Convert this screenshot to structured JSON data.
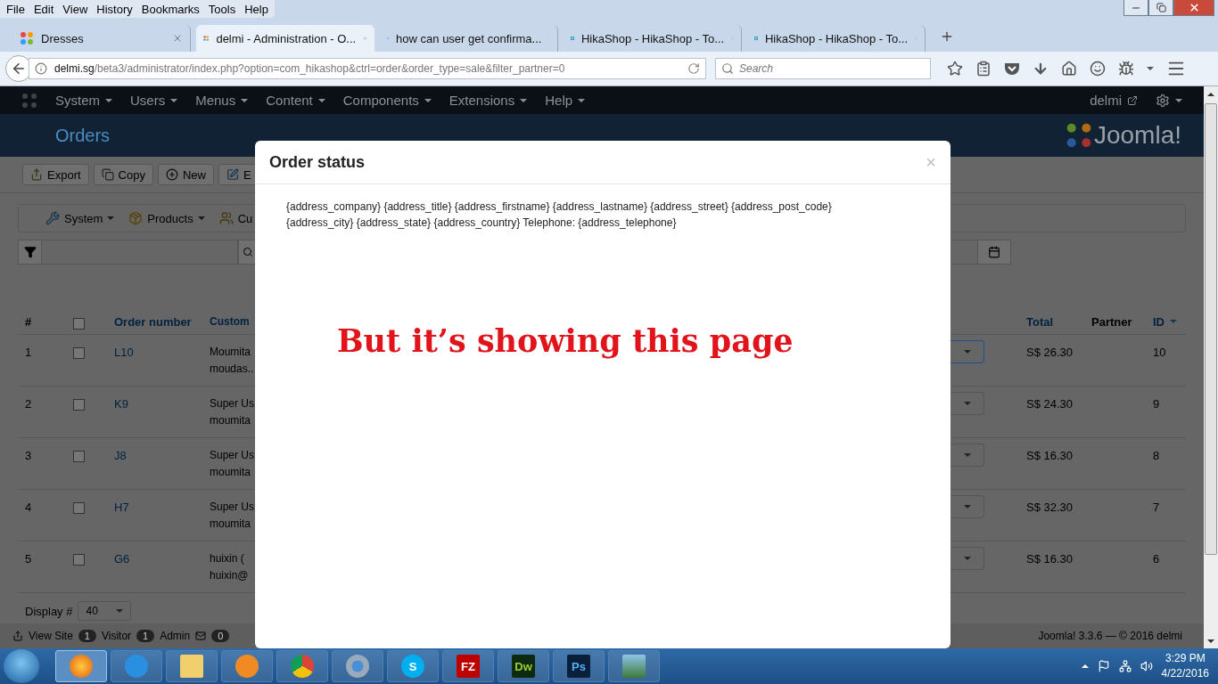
{
  "browser": {
    "menu": [
      "File",
      "Edit",
      "View",
      "History",
      "Bookmarks",
      "Tools",
      "Help"
    ],
    "tabs": [
      {
        "title": "Dresses",
        "kind": "joomla",
        "selected": false
      },
      {
        "title": "delmi - Administration - O...",
        "kind": "joomla",
        "selected": true
      },
      {
        "title": "how can user get confirma...",
        "kind": "google",
        "selected": false
      },
      {
        "title": "HikaShop - HikaShop - To...",
        "kind": "hikashop",
        "selected": false
      },
      {
        "title": "HikaShop - HikaShop - To...",
        "kind": "hikashop",
        "selected": false
      }
    ],
    "url": {
      "host": "delmi.sg",
      "path": "/beta3/administrator/index.php?option=com_hikashop&ctrl=order&order_type=sale&filter_partner=0"
    },
    "search": {
      "placeholder": "Search"
    }
  },
  "admin": {
    "nav": [
      "System",
      "Users",
      "Menus",
      "Content",
      "Components",
      "Extensions",
      "Help"
    ],
    "user": "delmi",
    "page_title": "Orders",
    "logo_text": "Joomla!",
    "toolbar": [
      {
        "label": "Export",
        "kind": "export"
      },
      {
        "label": "Copy",
        "kind": "copy"
      },
      {
        "label": "New",
        "kind": "new"
      },
      {
        "label": "E",
        "kind": "edit"
      }
    ],
    "submenu": [
      {
        "label": "System",
        "kind": "system"
      },
      {
        "label": "Products",
        "kind": "products"
      },
      {
        "label": "Cu",
        "kind": "customers"
      }
    ],
    "table": {
      "columns": [
        {
          "label": "#",
          "kind": "plain",
          "sorted": false
        },
        {
          "kind": "checkbox",
          "checked": false
        },
        {
          "label": "Order number",
          "kind": "link",
          "sorted": false
        },
        {
          "label": "Custom",
          "kind": "link"
        },
        {
          "label": "Total",
          "kind": "link",
          "sorted": false
        },
        {
          "label": "Partner",
          "kind": "plain",
          "sorted": false
        },
        {
          "label": "ID",
          "kind": "link",
          "sorted": true
        }
      ],
      "rows": [
        {
          "number": "1",
          "checked": false,
          "order_number": "L10",
          "customer": [
            "Moumita",
            "moudas.."
          ],
          "status_focused": true,
          "total": "S$ 26.30",
          "id": "10"
        },
        {
          "number": "2",
          "checked": false,
          "order_number": "K9",
          "customer": [
            "Super Us",
            "moumita"
          ],
          "status_focused": false,
          "total": "S$ 24.30",
          "id": "9"
        },
        {
          "number": "3",
          "checked": false,
          "order_number": "J8",
          "customer": [
            "Super Us",
            "moumita"
          ],
          "status_focused": false,
          "total": "S$ 16.30",
          "id": "8"
        },
        {
          "number": "4",
          "checked": false,
          "order_number": "H7",
          "customer": [
            "Super Us",
            "moumita"
          ],
          "status_focused": false,
          "total": "S$ 32.30",
          "id": "7"
        },
        {
          "number": "5",
          "checked": false,
          "order_number": "G6",
          "customer": [
            "huixin (",
            "huixin@"
          ],
          "status_focused": false,
          "total": "S$ 16.30",
          "id": "6"
        }
      ]
    },
    "display": {
      "label": "Display #",
      "value": "40"
    },
    "status_bar": {
      "view_site": "View Site",
      "visitors": {
        "count": "1",
        "label": "Visitor"
      },
      "admins": {
        "count": "1",
        "label": "Admin"
      },
      "messages": "0",
      "version": "Joomla! 3.3.6 — © 2016 delmi"
    }
  },
  "modal": {
    "title": "Order status",
    "close": "×",
    "body": "{address_company} {address_title} {address_firstname} {address_lastname} {address_street} {address_post_code} {address_city} {address_state} {address_country} Telephone: {address_telephone}"
  },
  "annotation": "But it’s showing this page",
  "taskbar": {
    "apps": [
      {
        "kind": "firefox",
        "selected": true
      },
      {
        "kind": "ie",
        "selected": false
      },
      {
        "kind": "explorer",
        "selected": false
      },
      {
        "kind": "media",
        "selected": false
      },
      {
        "kind": "chrome",
        "selected": false
      },
      {
        "kind": "chromium",
        "selected": false
      },
      {
        "kind": "skype",
        "label": "S",
        "selected": false
      },
      {
        "kind": "filezilla",
        "label": "FZ",
        "selected": false
      },
      {
        "kind": "dreamweaver",
        "label": "Dw",
        "selected": false
      },
      {
        "kind": "photoshop",
        "label": "Ps",
        "selected": false
      },
      {
        "kind": "photos",
        "selected": false
      }
    ],
    "clock": {
      "time": "3:29 PM",
      "date": "4/22/2016"
    }
  }
}
